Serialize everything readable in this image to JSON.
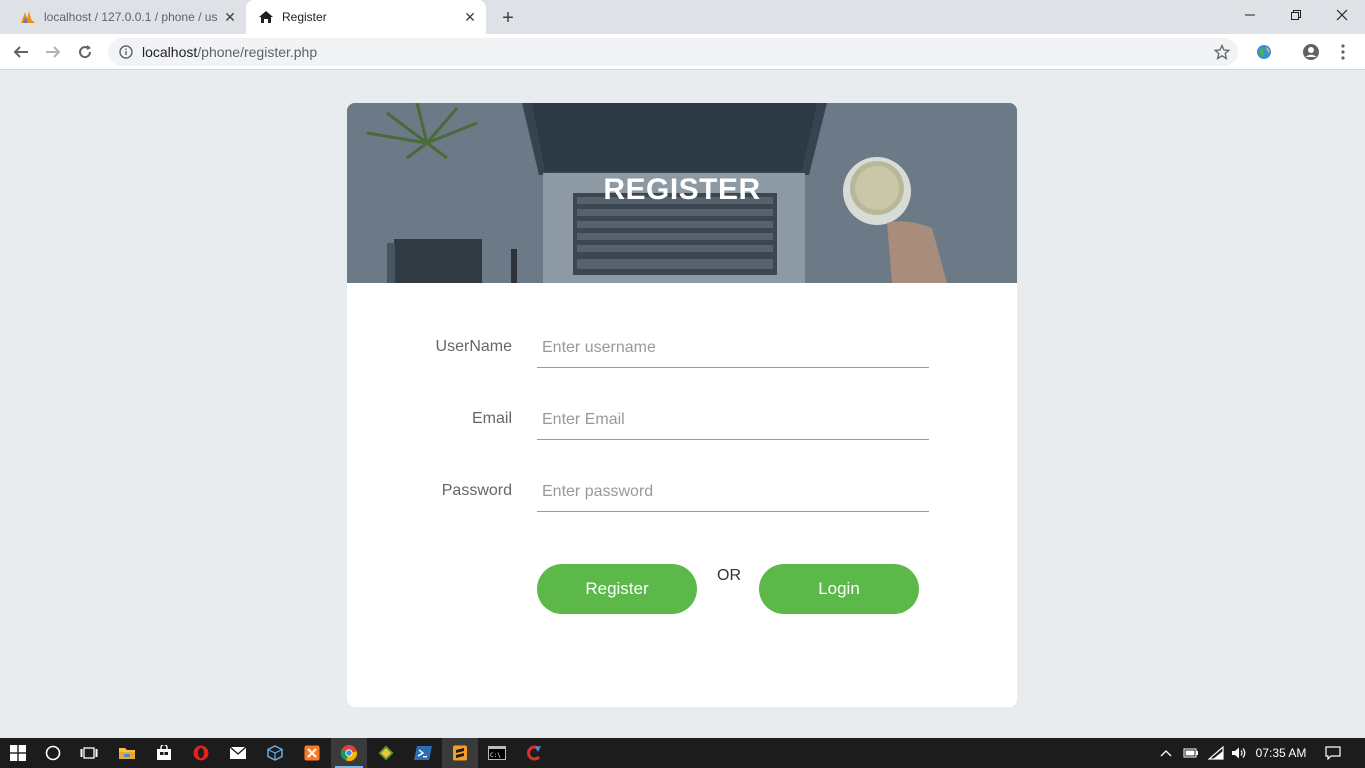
{
  "browser": {
    "tabs": [
      {
        "title": "localhost / 127.0.0.1 / phone / us",
        "favicon": "phpmyadmin-icon"
      },
      {
        "title": "Register",
        "favicon": "home-icon"
      }
    ],
    "url_host": "localhost",
    "url_path": "/phone/register.php"
  },
  "page": {
    "heading": "REGISTER",
    "fields": {
      "username": {
        "label": "UserName",
        "placeholder": "Enter username",
        "value": ""
      },
      "email": {
        "label": "Email",
        "placeholder": "Enter Email",
        "value": ""
      },
      "password": {
        "label": "Password",
        "placeholder": "Enter password",
        "value": ""
      }
    },
    "register_label": "Register",
    "or_label": "OR",
    "login_label": "Login",
    "accent_color": "#5cb848"
  },
  "taskbar": {
    "clock": "07:35 AM",
    "apps": [
      "windows-start-icon",
      "cortana-icon",
      "task-view-icon",
      "file-explorer-icon",
      "store-icon",
      "opera-icon",
      "mail-icon",
      "virtualbox-icon",
      "xampp-icon",
      "chrome-icon",
      "git-icon",
      "powershell-icon",
      "sublime-icon",
      "cmd-icon",
      "ccleaner-icon"
    ]
  }
}
